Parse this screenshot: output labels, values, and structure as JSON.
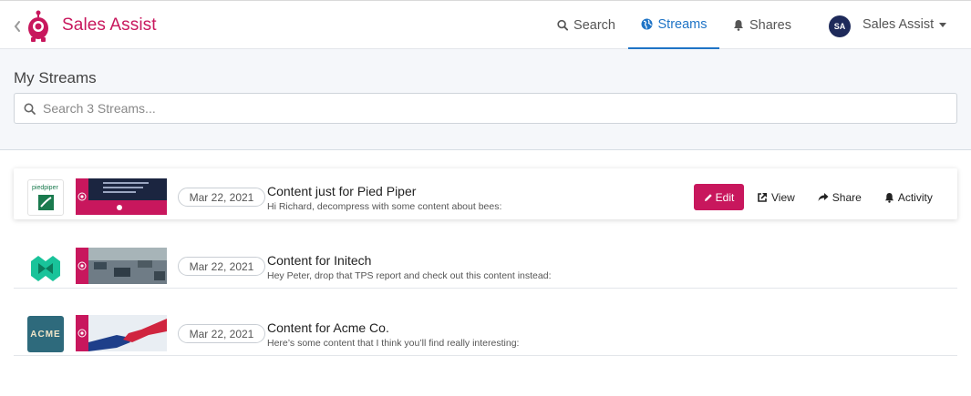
{
  "header": {
    "app_title": "Sales Assist",
    "nav": [
      {
        "label": "Search",
        "icon": "search-icon"
      },
      {
        "label": "Streams",
        "icon": "globe-icon",
        "active": true
      },
      {
        "label": "Shares",
        "icon": "bell-icon"
      }
    ],
    "user": {
      "initials": "SA",
      "name": "Sales Assist"
    }
  },
  "page": {
    "title": "My Streams",
    "search_placeholder": "Search 3 Streams..."
  },
  "streams": [
    {
      "company": "Pied Piper",
      "logo_text": "piedpiper",
      "date": "Mar 22, 2021",
      "title": "Content just for Pied Piper",
      "subtitle": "Hi Richard, decompress with some content about bees:",
      "highlighted": true
    },
    {
      "company": "Initech",
      "date": "Mar 22, 2021",
      "title": "Content for Initech",
      "subtitle": "Hey Peter, drop that TPS report and check out this content instead:"
    },
    {
      "company": "Acme Co.",
      "logo_text": "ACME",
      "date": "Mar 22, 2021",
      "title": "Content for Acme Co.",
      "subtitle": "Here’s some content that I think you’ll find really interesting:"
    }
  ],
  "actions": {
    "edit": "Edit",
    "view": "View",
    "share": "Share",
    "activity": "Activity"
  },
  "colors": {
    "brand": "#c8175d",
    "accent_blue": "#1f74c6",
    "avatar_bg": "#1e2a5a"
  }
}
